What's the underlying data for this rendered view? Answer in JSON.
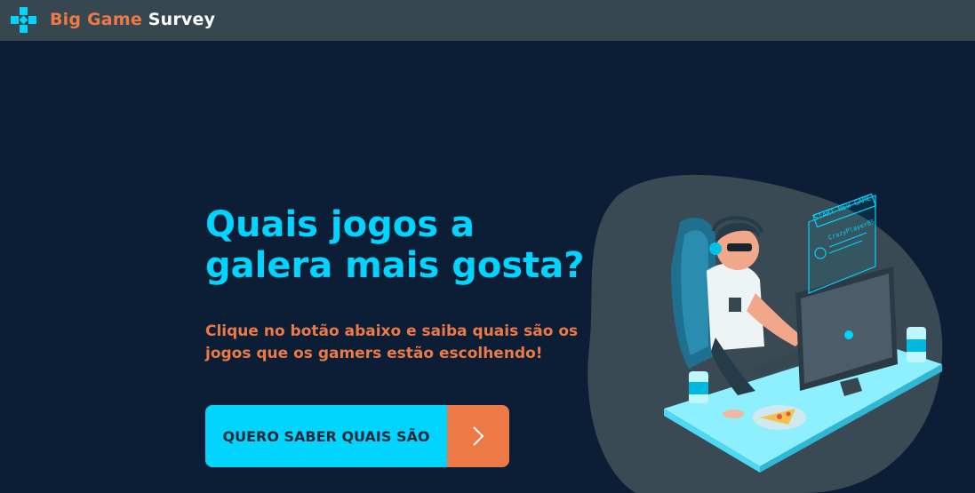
{
  "brand": {
    "name_part1": "Big Game",
    "name_part2": "Survey",
    "icon": "gamepad-cross-icon",
    "colors": {
      "orange": "#ed7947",
      "white": "#ffffff",
      "cyan": "#00d4ff"
    }
  },
  "hero": {
    "title_line1": "Quais jogos a",
    "title_line2": "galera mais gosta?",
    "subtitle_line1": "Clique no botão abaixo e saiba quais são os",
    "subtitle_line2": "jogos que os gamers estão escolhendo!",
    "cta_label": "QUERO SABER QUAIS SÃO",
    "cta_icon": "chevron-right-icon"
  },
  "illustration": {
    "icon": "gamer-at-desk-illustration",
    "screen_banner": "START NEW GAME",
    "player_name": "CrazyPlayer85"
  },
  "colors": {
    "background": "#0b1e35",
    "navbar": "#37474f",
    "accent_cyan": "#00d4ff",
    "accent_orange": "#ed7947"
  }
}
